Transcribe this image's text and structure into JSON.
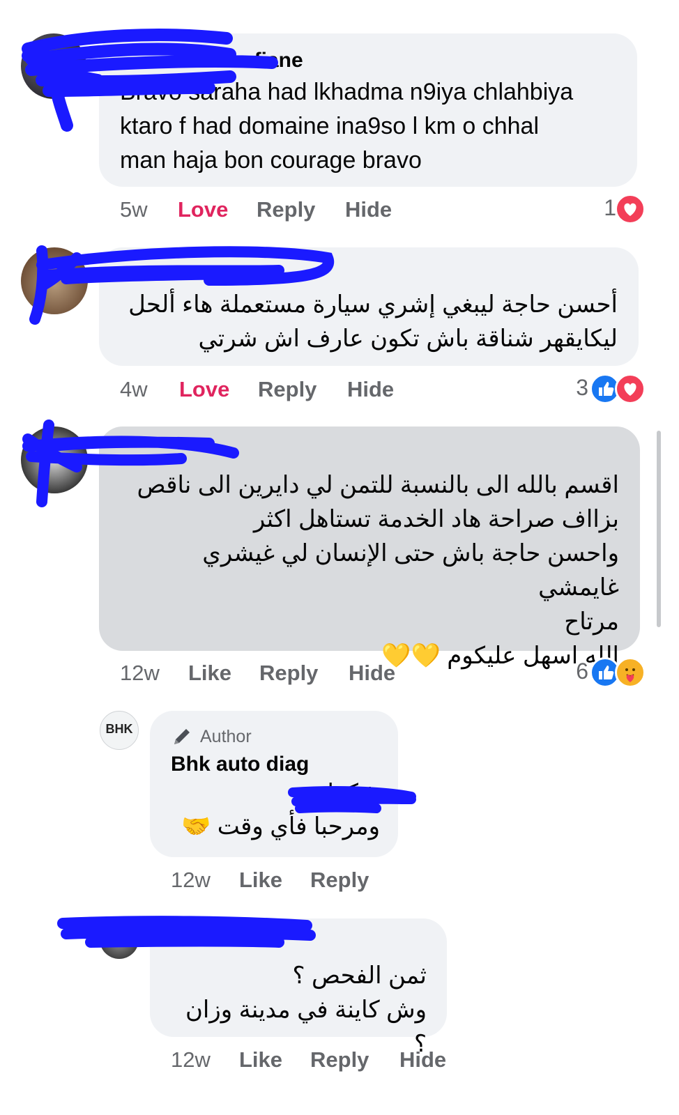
{
  "colors": {
    "bubble": "#f0f2f5",
    "bubble_pressed": "#d9dbde",
    "love": "#e0245e",
    "like_blue": "#1877f2",
    "heart_red": "#f33e58",
    "scribble": "#1a1aff",
    "muted": "#65676b"
  },
  "comments": [
    {
      "name": "Soufiane",
      "text": "Bravo saraha had lkhadma n9iya chlahbiya\nktaro f had domaine ina9so l km o chhal\nman haja bon courage bravo",
      "time": "5w",
      "action1": "Love",
      "reply": "Reply",
      "hide": "Hide",
      "reaction_count": "1",
      "reaction_icons": [
        "heart-icon"
      ]
    },
    {
      "name": "",
      "text": "أحسن حاجة ليبغي إشري سيارة مستعملة هاء ألحل\nليكايقهر شناقة  باش تكون عارف اش شرتي",
      "time": "4w",
      "action1": "Love",
      "reply": "Reply",
      "hide": "Hide",
      "reaction_count": "3",
      "reaction_icons": [
        "like-icon",
        "heart-icon"
      ]
    },
    {
      "name": "",
      "text": "اقسم بالله الى بالنسبة للتمن لي دايرين الى ناقص\nبزااف صراحة هاد الخدمة تستاهل اكثر\nواحسن حاجة باش حتى الإنسان لي غيشري غايمشي\nمرتاح\nالله اسهل عليكوم 💛💛",
      "time": "12w",
      "action1": "Like",
      "reply": "Reply",
      "hide": "Hide",
      "reaction_count": "6",
      "reaction_icons": [
        "like-icon",
        "care-icon"
      ]
    }
  ],
  "replies": [
    {
      "avatar_text": "BHK",
      "badge": "Author",
      "name": "Bhk auto diag",
      "line1": "شكرا",
      "mention": "ع",
      "line2": "ومرحبا فأي وقت",
      "emoji": "🤝",
      "time": "12w",
      "like": "Like",
      "reply": "Reply"
    },
    {
      "name": "",
      "text": "ثمن الفحص ؟\nوش كاينة في مدينة وزان ؟",
      "time": "12w",
      "like": "Like",
      "reply": "Reply",
      "hide": "Hide"
    }
  ]
}
